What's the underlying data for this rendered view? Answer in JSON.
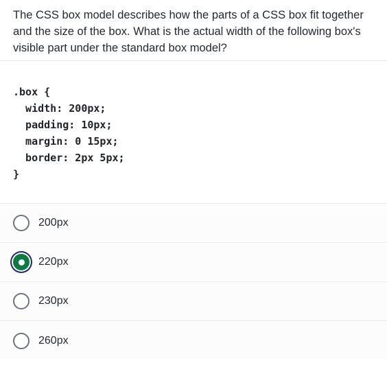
{
  "question": {
    "text": "The CSS box model describes how the parts of a CSS box fit together and the size of the box. What is the actual width of the following box's visible part under the standard box model?"
  },
  "code": {
    "lines": [
      ".box {",
      "  width: 200px;",
      "  padding: 10px;",
      "  margin: 0 15px;",
      "  border: 2px 5px;",
      "}"
    ]
  },
  "options": [
    {
      "label": "200px",
      "selected": false
    },
    {
      "label": "220px",
      "selected": true
    },
    {
      "label": "230px",
      "selected": false
    },
    {
      "label": "260px",
      "selected": false
    }
  ],
  "colors": {
    "selected_radio": "#0d7a43",
    "focus_ring": "#1c2b6b"
  }
}
